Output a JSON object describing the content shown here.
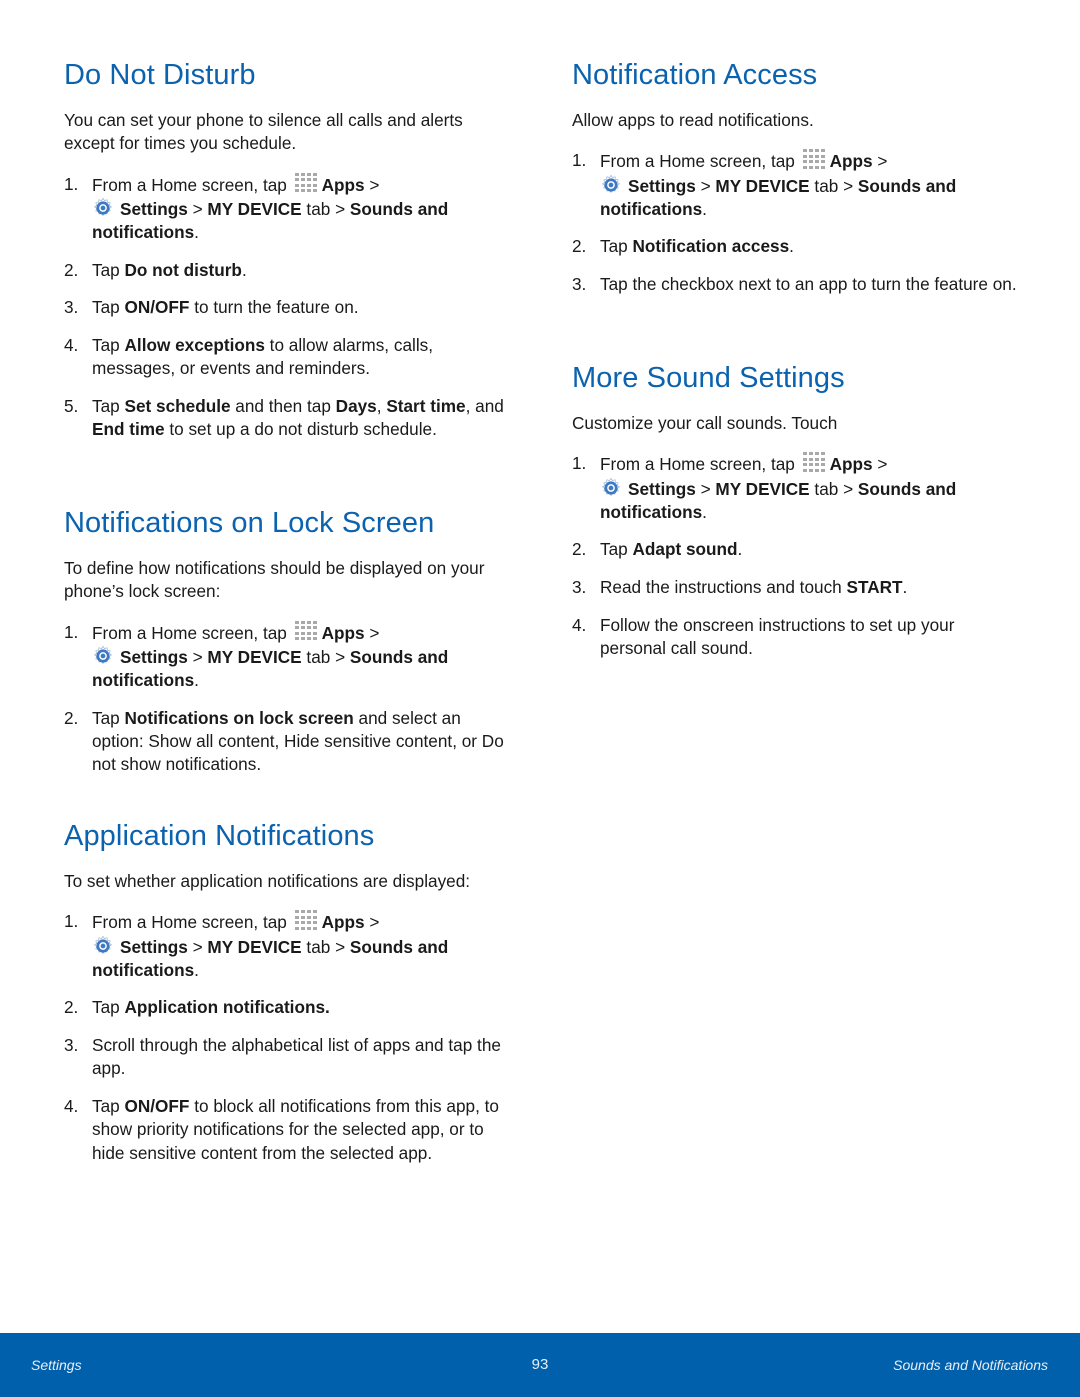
{
  "common": {
    "step1_prefix": "From a Home screen, tap ",
    "apps": "Apps",
    "gt": " >",
    "settings": "Settings",
    "sep": " > ",
    "my_device": "MY DEVICE",
    "tab": " tab > ",
    "sounds_and": "Sounds and",
    "notifications": "notifications",
    "period": "."
  },
  "sections": {
    "dnd": {
      "title": "Do Not Disturb",
      "intro": "You can set your phone to silence all calls and alerts except for times you schedule.",
      "steps": [
        {
          "num": "1."
        },
        {
          "num": "2.",
          "pre": "Tap ",
          "b1": "Do not disturb",
          "post": "."
        },
        {
          "num": "3.",
          "pre": "Tap ",
          "b1": "ON/OFF",
          "post": " to turn the feature on."
        },
        {
          "num": "4.",
          "pre": "Tap ",
          "b1": "Allow exceptions",
          "post": " to allow alarms, calls, messages, or events and reminders."
        },
        {
          "num": "5.",
          "pre": "Tap ",
          "b1": "Set schedule",
          "mid1": " and then tap ",
          "b2": "Days",
          "mid2": ", ",
          "b3": "Start time",
          "mid3": ", and ",
          "b4": "End time",
          "post": " to set up a do not disturb schedule."
        }
      ]
    },
    "lock": {
      "title": "Notifications on Lock Screen",
      "intro": "To define how notifications should be displayed on your phone’s lock screen:",
      "steps": [
        {
          "num": "1."
        },
        {
          "num": "2.",
          "pre": "Tap ",
          "b1": "Notifications on lock screen",
          "post": " and select an option: Show all content, Hide sensitive content, or Do not show notifications."
        }
      ]
    },
    "app": {
      "title": "Application Notifications",
      "intro": "To set whether application notifications are displayed:",
      "steps": [
        {
          "num": "1."
        },
        {
          "num": "2.",
          "pre": "Tap ",
          "b1": "Application notifications."
        },
        {
          "num": "3.",
          "pre": "Scroll through the alphabetical list of apps and tap the app."
        },
        {
          "num": "4.",
          "pre": "Tap ",
          "b1": "ON/OFF",
          "post": " to block all notifications from this app, to show priority notifications for the selected app, or to hide sensitive content from the selected app."
        }
      ]
    },
    "access": {
      "title": "Notification Access",
      "intro": "Allow apps to read notifications.",
      "steps": [
        {
          "num": "1."
        },
        {
          "num": "2.",
          "pre": "Tap ",
          "b1": "Notification access",
          "post": "."
        },
        {
          "num": "3.",
          "pre": "Tap the checkbox next to an app to turn the feature on."
        }
      ]
    },
    "sound": {
      "title": "More Sound Settings",
      "intro": "Customize your call sounds. Touch",
      "steps": [
        {
          "num": "1."
        },
        {
          "num": "2.",
          "pre": "Tap ",
          "b1": "Adapt sound",
          "post": "."
        },
        {
          "num": "3.",
          "pre": "Read the instructions and touch ",
          "b1": "START",
          "post": "."
        },
        {
          "num": "4.",
          "pre": "Follow the onscreen instructions to set up your personal call sound."
        }
      ]
    }
  },
  "icons": {
    "apps": "apps-grid-icon",
    "settings": "settings-gear-icon"
  },
  "colors": {
    "heading": "#0b62ae",
    "footer_bg": "#0060ab",
    "gear": "#3d79c4"
  },
  "footer": {
    "left": "Settings",
    "page": "93",
    "right": "Sounds and Notifications"
  }
}
